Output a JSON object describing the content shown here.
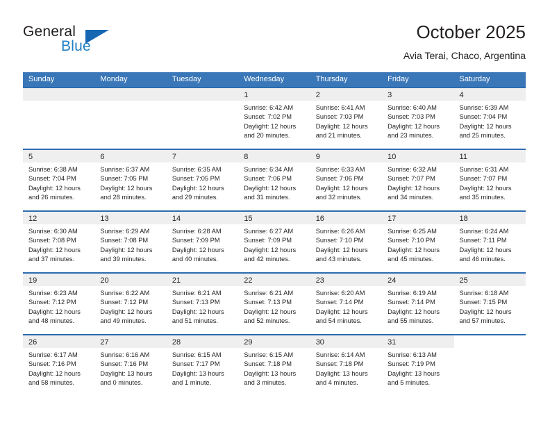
{
  "brand": {
    "name_top": "General",
    "name_bottom": "Blue",
    "accent_color": "#1567b2",
    "blue_text_color": "#1f7fc4"
  },
  "header": {
    "title": "October 2025",
    "subtitle": "Avia Terai, Chaco, Argentina"
  },
  "calendar": {
    "header_bg": "#3a77b8",
    "row_border_color": "#2a6cb0",
    "daynum_band_bg": "#efefef",
    "weekdays": [
      "Sunday",
      "Monday",
      "Tuesday",
      "Wednesday",
      "Thursday",
      "Friday",
      "Saturday"
    ],
    "weeks": [
      [
        {
          "day": "",
          "lines": []
        },
        {
          "day": "",
          "lines": []
        },
        {
          "day": "",
          "lines": []
        },
        {
          "day": "1",
          "lines": [
            "Sunrise: 6:42 AM",
            "Sunset: 7:02 PM",
            "Daylight: 12 hours",
            "and 20 minutes."
          ]
        },
        {
          "day": "2",
          "lines": [
            "Sunrise: 6:41 AM",
            "Sunset: 7:03 PM",
            "Daylight: 12 hours",
            "and 21 minutes."
          ]
        },
        {
          "day": "3",
          "lines": [
            "Sunrise: 6:40 AM",
            "Sunset: 7:03 PM",
            "Daylight: 12 hours",
            "and 23 minutes."
          ]
        },
        {
          "day": "4",
          "lines": [
            "Sunrise: 6:39 AM",
            "Sunset: 7:04 PM",
            "Daylight: 12 hours",
            "and 25 minutes."
          ]
        }
      ],
      [
        {
          "day": "5",
          "lines": [
            "Sunrise: 6:38 AM",
            "Sunset: 7:04 PM",
            "Daylight: 12 hours",
            "and 26 minutes."
          ]
        },
        {
          "day": "6",
          "lines": [
            "Sunrise: 6:37 AM",
            "Sunset: 7:05 PM",
            "Daylight: 12 hours",
            "and 28 minutes."
          ]
        },
        {
          "day": "7",
          "lines": [
            "Sunrise: 6:35 AM",
            "Sunset: 7:05 PM",
            "Daylight: 12 hours",
            "and 29 minutes."
          ]
        },
        {
          "day": "8",
          "lines": [
            "Sunrise: 6:34 AM",
            "Sunset: 7:06 PM",
            "Daylight: 12 hours",
            "and 31 minutes."
          ]
        },
        {
          "day": "9",
          "lines": [
            "Sunrise: 6:33 AM",
            "Sunset: 7:06 PM",
            "Daylight: 12 hours",
            "and 32 minutes."
          ]
        },
        {
          "day": "10",
          "lines": [
            "Sunrise: 6:32 AM",
            "Sunset: 7:07 PM",
            "Daylight: 12 hours",
            "and 34 minutes."
          ]
        },
        {
          "day": "11",
          "lines": [
            "Sunrise: 6:31 AM",
            "Sunset: 7:07 PM",
            "Daylight: 12 hours",
            "and 35 minutes."
          ]
        }
      ],
      [
        {
          "day": "12",
          "lines": [
            "Sunrise: 6:30 AM",
            "Sunset: 7:08 PM",
            "Daylight: 12 hours",
            "and 37 minutes."
          ]
        },
        {
          "day": "13",
          "lines": [
            "Sunrise: 6:29 AM",
            "Sunset: 7:08 PM",
            "Daylight: 12 hours",
            "and 39 minutes."
          ]
        },
        {
          "day": "14",
          "lines": [
            "Sunrise: 6:28 AM",
            "Sunset: 7:09 PM",
            "Daylight: 12 hours",
            "and 40 minutes."
          ]
        },
        {
          "day": "15",
          "lines": [
            "Sunrise: 6:27 AM",
            "Sunset: 7:09 PM",
            "Daylight: 12 hours",
            "and 42 minutes."
          ]
        },
        {
          "day": "16",
          "lines": [
            "Sunrise: 6:26 AM",
            "Sunset: 7:10 PM",
            "Daylight: 12 hours",
            "and 43 minutes."
          ]
        },
        {
          "day": "17",
          "lines": [
            "Sunrise: 6:25 AM",
            "Sunset: 7:10 PM",
            "Daylight: 12 hours",
            "and 45 minutes."
          ]
        },
        {
          "day": "18",
          "lines": [
            "Sunrise: 6:24 AM",
            "Sunset: 7:11 PM",
            "Daylight: 12 hours",
            "and 46 minutes."
          ]
        }
      ],
      [
        {
          "day": "19",
          "lines": [
            "Sunrise: 6:23 AM",
            "Sunset: 7:12 PM",
            "Daylight: 12 hours",
            "and 48 minutes."
          ]
        },
        {
          "day": "20",
          "lines": [
            "Sunrise: 6:22 AM",
            "Sunset: 7:12 PM",
            "Daylight: 12 hours",
            "and 49 minutes."
          ]
        },
        {
          "day": "21",
          "lines": [
            "Sunrise: 6:21 AM",
            "Sunset: 7:13 PM",
            "Daylight: 12 hours",
            "and 51 minutes."
          ]
        },
        {
          "day": "22",
          "lines": [
            "Sunrise: 6:21 AM",
            "Sunset: 7:13 PM",
            "Daylight: 12 hours",
            "and 52 minutes."
          ]
        },
        {
          "day": "23",
          "lines": [
            "Sunrise: 6:20 AM",
            "Sunset: 7:14 PM",
            "Daylight: 12 hours",
            "and 54 minutes."
          ]
        },
        {
          "day": "24",
          "lines": [
            "Sunrise: 6:19 AM",
            "Sunset: 7:14 PM",
            "Daylight: 12 hours",
            "and 55 minutes."
          ]
        },
        {
          "day": "25",
          "lines": [
            "Sunrise: 6:18 AM",
            "Sunset: 7:15 PM",
            "Daylight: 12 hours",
            "and 57 minutes."
          ]
        }
      ],
      [
        {
          "day": "26",
          "lines": [
            "Sunrise: 6:17 AM",
            "Sunset: 7:16 PM",
            "Daylight: 12 hours",
            "and 58 minutes."
          ]
        },
        {
          "day": "27",
          "lines": [
            "Sunrise: 6:16 AM",
            "Sunset: 7:16 PM",
            "Daylight: 13 hours",
            "and 0 minutes."
          ]
        },
        {
          "day": "28",
          "lines": [
            "Sunrise: 6:15 AM",
            "Sunset: 7:17 PM",
            "Daylight: 13 hours",
            "and 1 minute."
          ]
        },
        {
          "day": "29",
          "lines": [
            "Sunrise: 6:15 AM",
            "Sunset: 7:18 PM",
            "Daylight: 13 hours",
            "and 3 minutes."
          ]
        },
        {
          "day": "30",
          "lines": [
            "Sunrise: 6:14 AM",
            "Sunset: 7:18 PM",
            "Daylight: 13 hours",
            "and 4 minutes."
          ]
        },
        {
          "day": "31",
          "lines": [
            "Sunrise: 6:13 AM",
            "Sunset: 7:19 PM",
            "Daylight: 13 hours",
            "and 5 minutes."
          ]
        },
        {
          "day": "",
          "lines": [],
          "blank": true
        }
      ]
    ]
  }
}
